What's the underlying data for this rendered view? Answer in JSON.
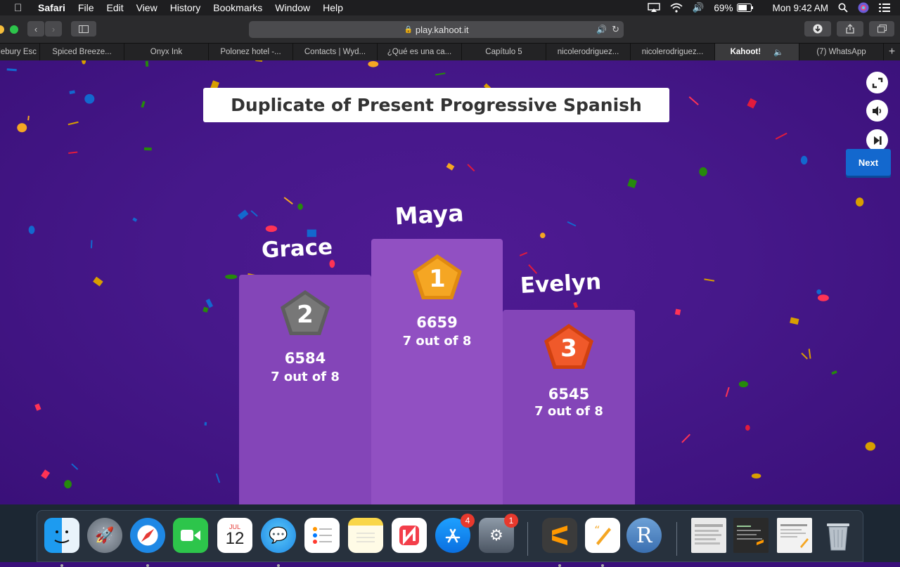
{
  "menubar": {
    "app": "Safari",
    "items": [
      "File",
      "Edit",
      "View",
      "History",
      "Bookmarks",
      "Window",
      "Help"
    ],
    "battery": "69%",
    "clock": "Mon 9:42 AM"
  },
  "browser": {
    "url": "play.kahoot.it",
    "tabs": [
      "ddlebury Esc",
      "Spiced Breeze...",
      "Onyx Ink",
      "Polonez hotel -...",
      "Contacts | Wyd...",
      "¿Qué es una ca...",
      "Capítulo 5",
      "nicolerodriguez...",
      "nicolerodriguez...",
      "Kahoot!",
      "(7) WhatsApp"
    ],
    "active_tab": 9
  },
  "quiz": {
    "title": "Duplicate of Present Progressive Spanish",
    "next_label": "Next",
    "podium": {
      "first": {
        "rank": "1",
        "name": "Maya",
        "score": "6659",
        "correct": "7 out of 8",
        "medal_color": "#f5a623"
      },
      "second": {
        "rank": "2",
        "name": "Grace",
        "score": "6584",
        "correct": "7 out of 8",
        "medal_color": "#777777"
      },
      "third": {
        "rank": "3",
        "name": "Evelyn",
        "score": "6545",
        "correct": "7 out of 8",
        "medal_color": "#f0592a"
      }
    }
  },
  "dock": {
    "calendar_month": "JUL",
    "calendar_day": "12",
    "appstore_badge": "4",
    "settings_badge": "1"
  },
  "colors": {
    "stage_bg": "#46188a",
    "podium": "#8e4cbc",
    "next_button": "#1368ce"
  }
}
